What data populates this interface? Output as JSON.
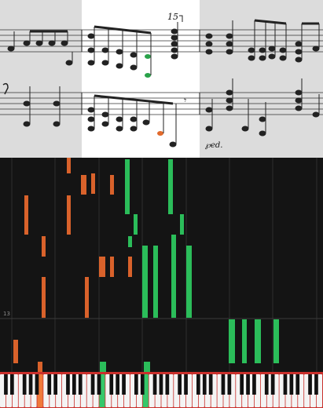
{
  "score": {
    "measure_number": "15",
    "pedal_mark": "℘ed.",
    "colors": {
      "sheet": "#dcdcdc",
      "highlight_page": "#ffffff",
      "note_green": "#2aa24a",
      "note_orange": "#e26a2c"
    }
  },
  "piano_roll": {
    "bar_label": "13",
    "colors": {
      "background": "#141414",
      "orange_note": "#d9622b",
      "green_note": "#2bbd5a",
      "grid": "#3a3a3a"
    }
  },
  "keyboard": {
    "pressed_colors": {
      "orange": "#f07a3a",
      "green": "#35c86a"
    }
  }
}
